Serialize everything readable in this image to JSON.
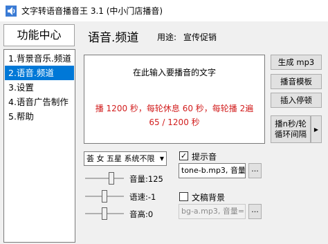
{
  "window": {
    "title": "文字转语音播音王 3.1 (中小门店播音)"
  },
  "sidebar": {
    "header": "功能中心",
    "items": [
      {
        "label": "1.背景音乐.频道"
      },
      {
        "label": "2.语音.频道"
      },
      {
        "label": "3.设置"
      },
      {
        "label": "4.语音广告制作"
      },
      {
        "label": "5.帮助"
      }
    ],
    "selected_index": 1
  },
  "main": {
    "title": "语音.频道",
    "purpose_label": "用途:",
    "purpose_value": "宣传促销",
    "text_area": {
      "placeholder": "在此输入要播音的文字",
      "info_line1": "播 1200 秒，每轮休息 60 秒，每轮播 2遍",
      "info_line2": "65 / 1200 秒"
    },
    "voice_select": "荟 女 五星 系统不限",
    "volume_label": "音量:125",
    "speed_label": "语速:-1",
    "pitch_label": "音高:0",
    "sliders": {
      "volume_fraction": 0.68,
      "speed_fraction": 0.5,
      "pitch_fraction": 0.5
    },
    "prompt_tone": {
      "label": "提示音",
      "checked": true,
      "value": "tone-b.mp3, 音量"
    },
    "doc_background": {
      "label": "文稿背景",
      "checked": false,
      "value": "bg-a.mp3, 音量=("
    },
    "browse_label": "..."
  },
  "buttons": {
    "generate": "生成 mp3",
    "template": "播音模板",
    "insert_pause": "插入停顿",
    "loop_line1": "播n秒/轮",
    "loop_line2": "循环间隔",
    "loop_arrow": "▶"
  },
  "colors": {
    "accent": "#0078d7",
    "info_text": "#d21e1e"
  }
}
